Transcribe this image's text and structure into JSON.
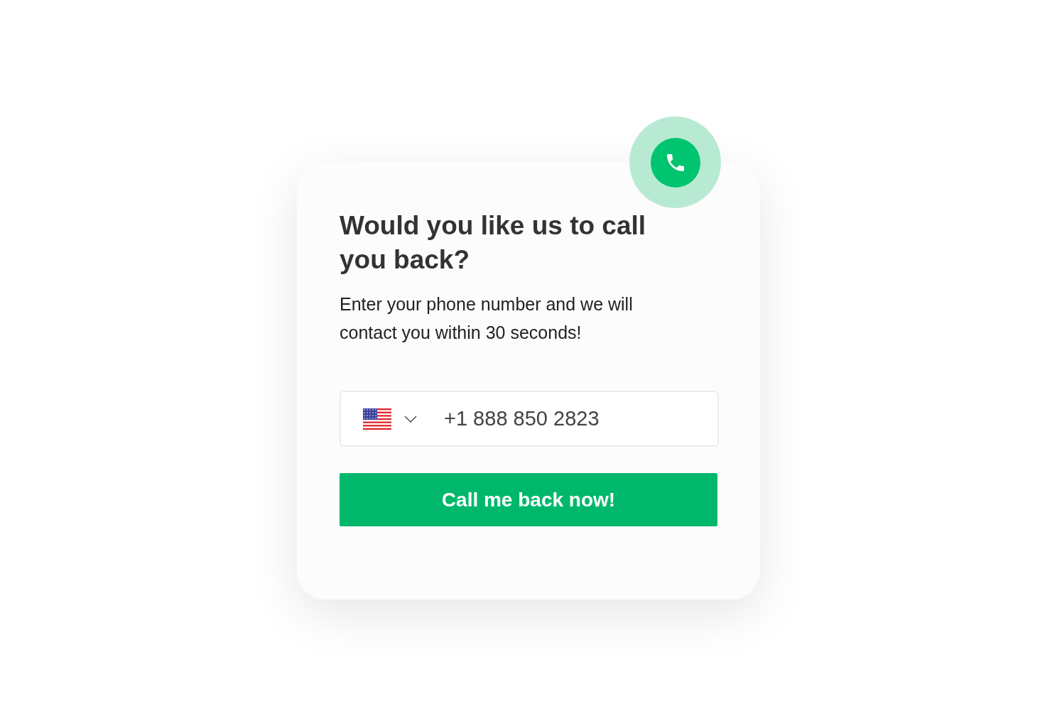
{
  "callback_card": {
    "title": "Would you like us to call you back?",
    "description": "Enter your phone number and we will contact you within 30 seconds!",
    "phone_field": {
      "value": "+1 888 850 2823"
    },
    "submit_button": "Call me back now!"
  }
}
